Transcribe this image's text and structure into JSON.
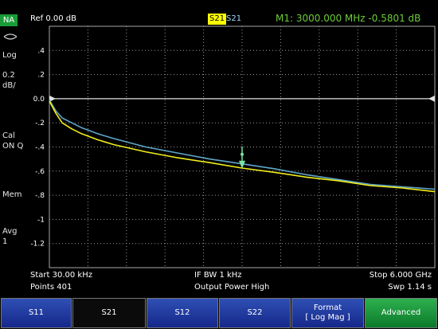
{
  "header": {
    "mode": "NA",
    "reference": "Ref 0.00 dB",
    "active_trace": "S21",
    "second_trace": "S21",
    "marker_readout": "M1:  3000.000 MHz  -0.5801 dB"
  },
  "sidebar": {
    "format": "Log",
    "scale": "0.2\ndB/",
    "cal": "Cal\nON Q",
    "mem": "Mem",
    "avg": "Avg\n1"
  },
  "plot": {
    "y_ticks": [
      ".4",
      ".2",
      "0.0",
      "-.2",
      "-.4",
      "-.6",
      "-.8",
      "-1",
      "-1.2"
    ],
    "colors": {
      "grid": "#9a9a9a",
      "trace_yellow": "#f2ee1a",
      "trace_blue": "#5fa6c9",
      "marker": "#7be3a0",
      "frame": "#a8a8a8"
    }
  },
  "chart_data": {
    "type": "line",
    "xlim": [
      3e-05,
      6.0
    ],
    "ylim": [
      -1.4,
      0.6
    ],
    "x_unit": "GHz",
    "y_unit": "dB",
    "reference_level": 0.0,
    "marker": {
      "name": "M1",
      "x": 3.0,
      "y": -0.5801
    },
    "series": [
      {
        "color": "#f2ee1a",
        "x": [
          3e-05,
          0.1,
          0.2,
          0.35,
          0.5,
          0.75,
          1.0,
          1.5,
          2.0,
          2.5,
          3.0,
          3.5,
          4.0,
          4.5,
          5.0,
          5.5,
          6.0
        ],
        "y": [
          -0.02,
          -0.12,
          -0.2,
          -0.25,
          -0.29,
          -0.34,
          -0.38,
          -0.44,
          -0.49,
          -0.53,
          -0.575,
          -0.61,
          -0.65,
          -0.68,
          -0.72,
          -0.74,
          -0.77
        ]
      },
      {
        "color": "#5fa6c9",
        "x": [
          3e-05,
          0.1,
          0.2,
          0.35,
          0.5,
          0.75,
          1.0,
          1.5,
          2.0,
          2.5,
          3.0,
          3.5,
          4.0,
          4.5,
          5.0,
          5.5,
          6.0
        ],
        "y": [
          -0.01,
          -0.1,
          -0.16,
          -0.2,
          -0.24,
          -0.29,
          -0.33,
          -0.4,
          -0.45,
          -0.5,
          -0.54,
          -0.58,
          -0.63,
          -0.67,
          -0.71,
          -0.73,
          -0.75
        ]
      }
    ]
  },
  "footer": {
    "start": "Start 30.00 kHz",
    "ifbw": "IF BW 1 kHz",
    "stop": "Stop 6.000 GHz",
    "points": "Points 401",
    "power": "Output Power High",
    "sweep": "Swp 1.14 s"
  },
  "softkeys": [
    {
      "label": "S11"
    },
    {
      "label": "S21"
    },
    {
      "label": "S12"
    },
    {
      "label": "S22"
    },
    {
      "label": "Format",
      "sub": "[ Log Mag ]"
    },
    {
      "label": "Advanced"
    }
  ]
}
